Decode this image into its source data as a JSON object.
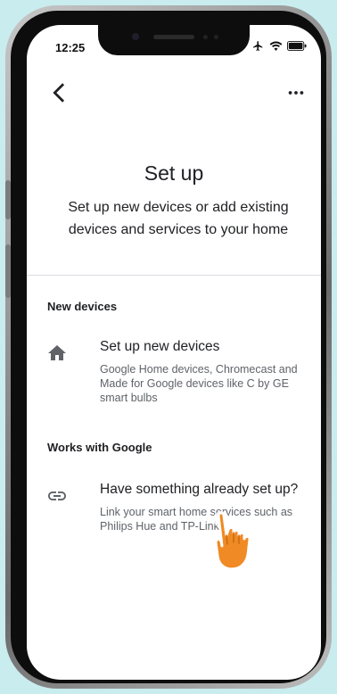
{
  "status_bar": {
    "time": "12:25"
  },
  "header": {
    "back_icon": "chevron-left-icon",
    "more_icon": "more-horizontal-icon",
    "title": "Set up",
    "subtitle": "Set up new devices or add existing devices and services to your home"
  },
  "sections": [
    {
      "heading": "New devices",
      "items": [
        {
          "icon": "home-icon",
          "label": "Set up new devices",
          "description": "Google Home devices, Chromecast and Made for Google devices like C by GE smart bulbs"
        }
      ]
    },
    {
      "heading": "Works with Google",
      "items": [
        {
          "icon": "link-icon",
          "label": "Have something already set up?",
          "description": "Link your smart home services such as Philips Hue and TP-Link"
        }
      ]
    }
  ],
  "overlay": {
    "pointer_icon": "tap-hand-icon"
  },
  "colors": {
    "background": "#c9ecef",
    "text_primary": "#202124",
    "text_secondary": "#5f6368",
    "icon": "#5f6368",
    "hand": "#f08a24"
  }
}
